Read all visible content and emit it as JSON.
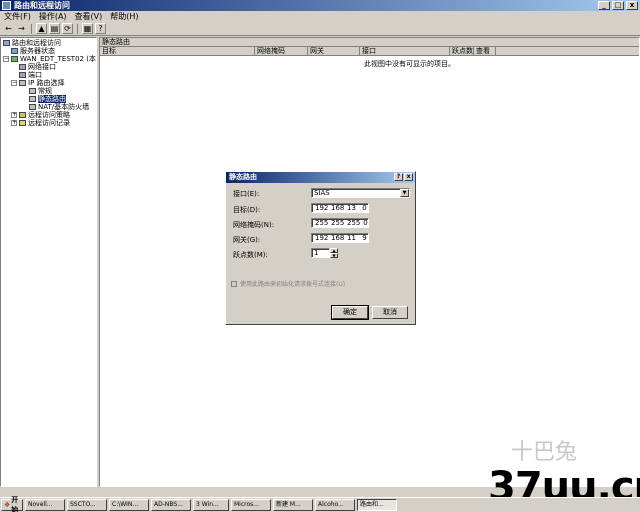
{
  "window": {
    "title": "路由和远程访问",
    "min": "_",
    "max": "□",
    "close": "x"
  },
  "menu": [
    "文件(F)",
    "操作(A)",
    "查看(V)",
    "帮助(H)"
  ],
  "toolbar": [
    "back-icon",
    "forward-icon",
    "up-icon",
    "properties-icon",
    "refresh-icon",
    "export-icon",
    "help-icon"
  ],
  "tree": {
    "root": "路由和远程访问",
    "items": [
      "服务器状态",
      "WAN_EDT_TEST02 (本地)",
      "网络接口",
      "端口",
      "IP 路由选择",
      "常规",
      "静态路由",
      "NAT/基本防火墙",
      "远程访问策略",
      "远程访问记录"
    ]
  },
  "list": {
    "title": "静态路由",
    "columns": [
      "目标",
      "网络掩码",
      "网关",
      "接口",
      "跃点数",
      "查看"
    ],
    "empty": "此视图中没有可显示的项目。"
  },
  "dialog": {
    "title": "静态路由",
    "help": "?",
    "close": "x",
    "interface_label": "接口(E):",
    "interface_value": "SIAS",
    "target_label": "目标(D):",
    "target": [
      "192",
      "168",
      "13",
      "0"
    ],
    "mask_label": "网络掩码(N):",
    "mask": [
      "255",
      "255",
      "255",
      "0"
    ],
    "gateway_label": "网关(G):",
    "gateway": [
      "192",
      "168",
      "11",
      "9"
    ],
    "metric_label": "跃点数(M):",
    "metric": "1",
    "checkbox": "使用此路由来初始化请求拨号式连接(U)",
    "ok": "确定",
    "cancel": "取消"
  },
  "taskbar": {
    "start": "开始",
    "tasks": [
      "Novell...",
      "SSCTO...",
      "C:\\WIN...",
      "AD-NBS...",
      "3 Win...",
      "Micros...",
      "新建 M...",
      "Alcoho...",
      "路由和..."
    ]
  },
  "watermark": {
    "text": "37uu.cn",
    "faint": "十巴兔"
  }
}
